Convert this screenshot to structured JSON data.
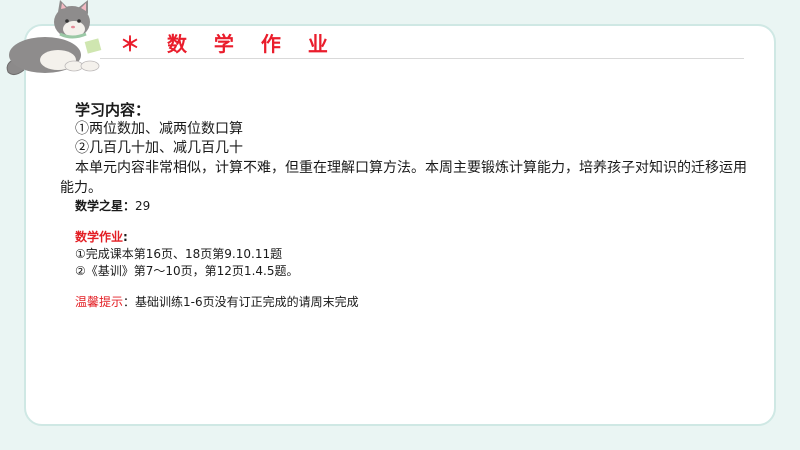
{
  "header": {
    "title": "＊ 数 学 作 业"
  },
  "study": {
    "heading": "学习内容：",
    "item1": "①两位数加、减两位数口算",
    "item2": "②几百几十加、减几百几十",
    "paragraph": "本单元内容非常相似，计算不难，但重在理解口算方法。本周主要锻炼计算能力，培养孩子对知识的迁移运用能力。",
    "star_label": "数学之星：",
    "star_value": "29"
  },
  "homework": {
    "heading": "数学作业",
    "heading_colon": ":",
    "item1": "①完成课本第16页、18页第9.10.11题",
    "item2": "②《基训》第7～10页，第12页1.4.5题。"
  },
  "reminder": {
    "label": "温馨提示",
    "text": "：基础训练1-6页没有订正完成的请周末完成"
  },
  "colors": {
    "accent": "#ea1d2c",
    "background": "#eaf5f3",
    "card_border": "#cfe8e4"
  }
}
